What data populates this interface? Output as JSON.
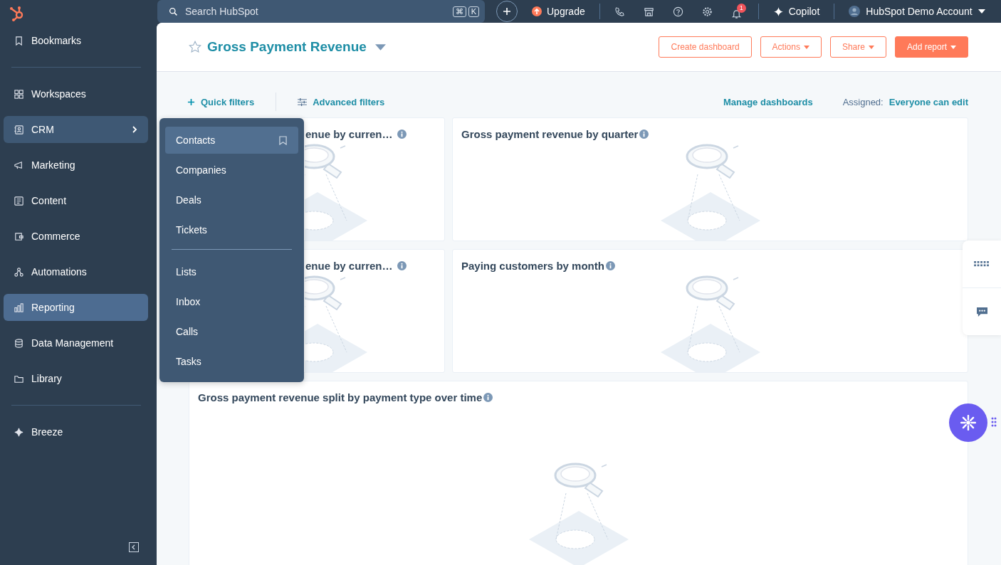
{
  "topbar": {
    "search": {
      "placeholder": "Search HubSpot",
      "keys": [
        "⌘",
        "K"
      ]
    },
    "upgrade": "Upgrade",
    "notifications": {
      "count": "1"
    },
    "copilot": "Copilot",
    "account": "HubSpot Demo Account"
  },
  "sidebar": {
    "groups": [
      [
        {
          "label": "Bookmarks",
          "selected": false,
          "open": false
        }
      ],
      [
        {
          "label": "Workspaces",
          "selected": false,
          "open": false
        },
        {
          "label": "CRM",
          "selected": false,
          "open": true
        },
        {
          "label": "Marketing",
          "selected": false,
          "open": false
        },
        {
          "label": "Content",
          "selected": false,
          "open": false
        },
        {
          "label": "Commerce",
          "selected": false,
          "open": false
        },
        {
          "label": "Automations",
          "selected": false,
          "open": false
        },
        {
          "label": "Reporting",
          "selected": true,
          "open": false
        },
        {
          "label": "Data Management",
          "selected": false,
          "open": false
        },
        {
          "label": "Library",
          "selected": false,
          "open": false
        }
      ],
      [
        {
          "label": "Breeze",
          "selected": false,
          "open": false
        }
      ]
    ]
  },
  "header": {
    "title": "Gross Payment Revenue",
    "favorite": false,
    "buttons": [
      {
        "label": "Create dashboard",
        "kind": "outline",
        "caret": false
      },
      {
        "label": "Actions",
        "kind": "outline",
        "caret": true
      },
      {
        "label": "Share",
        "kind": "outline",
        "caret": true
      },
      {
        "label": "Add report",
        "kind": "primary",
        "caret": true
      }
    ]
  },
  "filters": {
    "quick": "Quick filters",
    "advanced": "Advanced filters",
    "manage": "Manage dashboards",
    "assigned_label": "Assigned:",
    "assigned_value": "Everyone can edit"
  },
  "cards": [
    [
      {
        "title": "enue by curren…"
      },
      {
        "title": "Gross payment revenue by quarter"
      }
    ],
    [
      {
        "title": "enue by curren…"
      },
      {
        "title": "Paying customers by month"
      }
    ],
    [
      {
        "title": "Gross payment revenue split by payment type over time"
      }
    ]
  ],
  "crm_menu": {
    "groups": [
      [
        {
          "label": "Contacts",
          "hovered": true
        },
        {
          "label": "Companies",
          "hovered": false
        },
        {
          "label": "Deals",
          "hovered": false
        },
        {
          "label": "Tickets",
          "hovered": false
        }
      ],
      [
        {
          "label": "Lists",
          "hovered": false
        },
        {
          "label": "Inbox",
          "hovered": false
        },
        {
          "label": "Calls",
          "hovered": false
        },
        {
          "label": "Tasks",
          "hovered": false
        }
      ]
    ]
  }
}
